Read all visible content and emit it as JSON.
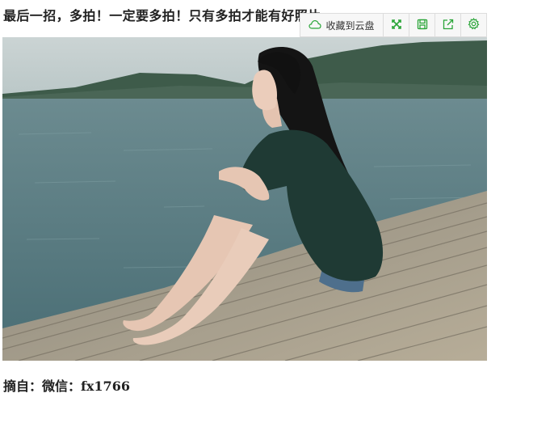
{
  "article": {
    "headline": "最后一招，多拍！一定要多拍！只有多拍才能有好照片",
    "caption": "摘自：微信：fx1766"
  },
  "toolbar": {
    "save_to_cloud_label": "收藏到云盘",
    "icons": [
      "cloud-icon",
      "fullscreen-icon",
      "save-icon",
      "share-icon",
      "gear-icon"
    ],
    "accent_color": "#2aa538"
  },
  "photo": {
    "subject": "woman sitting on bamboo raft by a lake",
    "colors": {
      "sky": "#c9d3d3",
      "hills": "#3c5a48",
      "water": "#5f7f86",
      "raft": "#a39b89",
      "shirt": "#1f3a34",
      "hair": "#141414",
      "skin": "#e7c8b6"
    }
  }
}
